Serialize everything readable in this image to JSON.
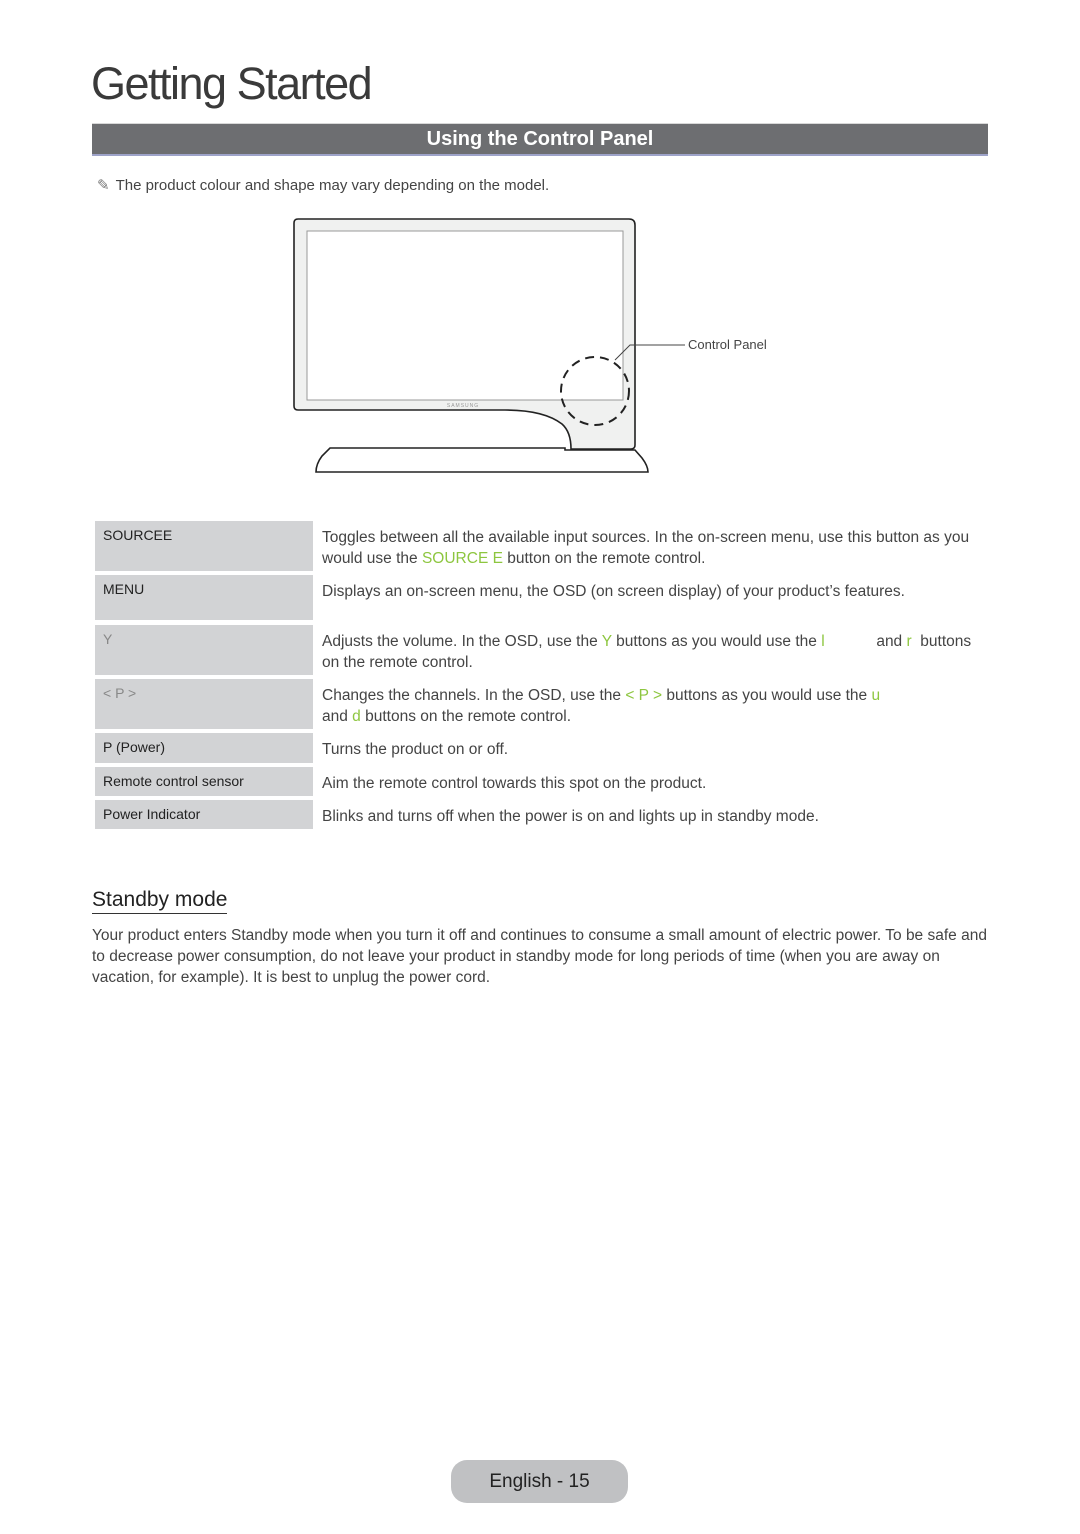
{
  "chapter_title": "Getting Started",
  "section_title": "Using the Control Panel",
  "note": {
    "icon": "pencil-icon",
    "text": "The product colour and shape may vary depending on the model."
  },
  "diagram": {
    "brand": "SAMSUNG",
    "callout_label": "Control Panel"
  },
  "controls": [
    {
      "label": "SOURCEE",
      "desc_parts": [
        "Toggles between all the available input sources. In the on-screen menu, use this button as you would use the ",
        "SOURCE E",
        " button on the remote control."
      ]
    },
    {
      "label": "MENU",
      "desc_parts": [
        "Displays an on-screen menu, the OSD (on screen display) of your product’s features."
      ]
    },
    {
      "label": "Y",
      "desc_parts": [
        "Adjusts the volume. In the OSD, use the ",
        "Y",
        " buttons as you would use the ",
        "l",
        "            and ",
        "r",
        "  buttons on the remote control."
      ]
    },
    {
      "label": "< P >",
      "desc_parts": [
        "Changes the channels. In the OSD, use the ",
        "< P >",
        " buttons as you would use the ",
        "u",
        " and ",
        "d",
        " buttons on the remote control."
      ]
    },
    {
      "label": "P (Power)",
      "desc_parts": [
        "Turns the product on or off."
      ]
    },
    {
      "label": "Remote control sensor",
      "desc_parts": [
        "Aim the remote control towards this spot on the product."
      ]
    },
    {
      "label": "Power Indicator",
      "desc_parts": [
        "Blinks and turns off when the power is on and lights up in standby mode."
      ]
    }
  ],
  "standby": {
    "heading": "Standby mode",
    "text": "Your product enters Standby mode when you turn it off and continues to consume a small amount of electric power. To be safe and to decrease power consumption, do not leave your product in standby mode for long periods of time (when you are away on vacation, for example). It is best to unplug the power cord."
  },
  "footer": {
    "page_label": "English - 15"
  },
  "colors": {
    "accent_green": "#8dc63f",
    "section_bar": "#6d6e71",
    "label_cell": "#d2d3d5",
    "page_pill": "#c0c1c3"
  }
}
